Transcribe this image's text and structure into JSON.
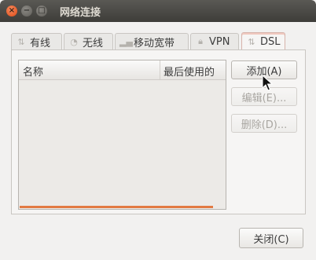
{
  "window": {
    "title": "网络连接"
  },
  "tabs": [
    {
      "label": "有线",
      "icon": "wired-icon"
    },
    {
      "label": "无线",
      "icon": "wireless-icon"
    },
    {
      "label": "移动宽带",
      "icon": "mobile-broadband-icon"
    },
    {
      "label": "VPN",
      "icon": "lock-icon"
    },
    {
      "label": "DSL",
      "icon": "dsl-icon",
      "active": true
    }
  ],
  "list": {
    "columns": [
      "名称",
      "最后使用的"
    ]
  },
  "buttons": {
    "add": "添加(A)",
    "edit": "编辑(E)...",
    "delete": "删除(D)...",
    "close": "关闭(C)"
  },
  "colors": {
    "accent": "#e27a43",
    "titlebar": "#3e3d39"
  }
}
